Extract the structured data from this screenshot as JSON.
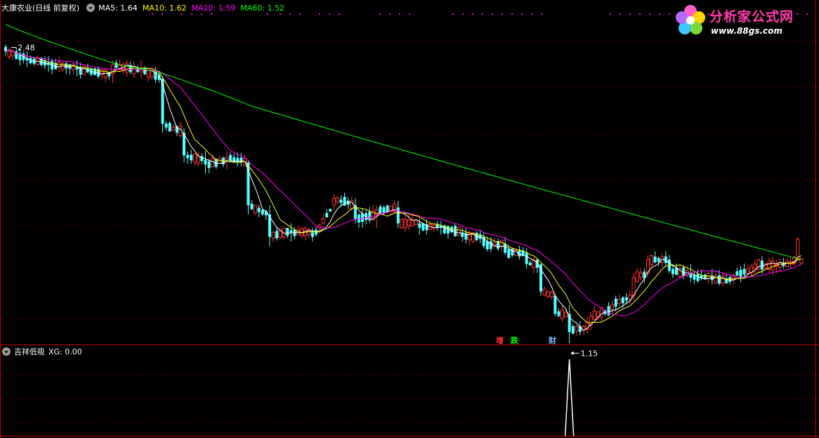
{
  "header": {
    "stock_title": "大康农业(日线 前复权)",
    "ma5": "MA5: 1.64",
    "ma10": "MA10: 1.62",
    "ma20": "MA20: 1.59",
    "ma60": "MA60: 1.52"
  },
  "indicator_header": {
    "name": "吉祥低吸",
    "value": "XG: 0.00"
  },
  "logo": {
    "text": "分析家公式网",
    "url": "www.88gs.com"
  },
  "labels": {
    "zeng": "增",
    "die": "跌",
    "cai": "财"
  },
  "colors": {
    "up": "#ff3232",
    "down": "#54ffff",
    "ma5": "#ffffff",
    "ma10": "#ffff00",
    "ma20": "#ff00ff",
    "ma60": "#00ff00",
    "grid": "#8b0000",
    "axis": "#c00000"
  },
  "chart_data": {
    "type": "candlestick",
    "y_range": [
      1.12,
      2.58
    ],
    "annotations": [
      {
        "text": "2.48",
        "at": "high"
      },
      {
        "text": "1.15",
        "at": "low"
      }
    ],
    "ohlc_ref": [
      [
        0,
        2.46,
        2.47,
        2.42,
        2.44
      ],
      [
        6,
        2.41,
        2.44,
        2.37,
        2.4
      ],
      [
        12,
        2.39,
        2.42,
        2.35,
        2.38
      ],
      [
        20,
        2.37,
        2.4,
        2.33,
        2.36
      ],
      [
        30,
        2.34,
        2.4,
        2.3,
        2.38
      ],
      [
        38,
        2.35,
        2.4,
        2.32,
        2.36
      ],
      [
        44,
        2.32,
        2.33,
        2.08,
        2.12
      ],
      [
        50,
        2.08,
        2.1,
        1.95,
        1.98
      ],
      [
        56,
        1.96,
        2.0,
        1.9,
        1.94
      ],
      [
        62,
        1.96,
        2.0,
        1.92,
        1.97
      ],
      [
        68,
        1.95,
        1.96,
        1.72,
        1.76
      ],
      [
        74,
        1.72,
        1.76,
        1.58,
        1.62
      ],
      [
        80,
        1.65,
        1.68,
        1.6,
        1.64
      ],
      [
        86,
        1.64,
        1.66,
        1.6,
        1.62
      ],
      [
        92,
        1.76,
        1.81,
        1.74,
        1.79
      ],
      [
        98,
        1.76,
        1.79,
        1.68,
        1.7
      ],
      [
        104,
        1.72,
        1.76,
        1.66,
        1.74
      ],
      [
        110,
        1.75,
        1.78,
        1.66,
        1.68
      ],
      [
        116,
        1.68,
        1.7,
        1.63,
        1.66
      ],
      [
        122,
        1.67,
        1.69,
        1.63,
        1.66
      ],
      [
        128,
        1.64,
        1.66,
        1.6,
        1.62
      ],
      [
        134,
        1.62,
        1.64,
        1.57,
        1.58
      ],
      [
        140,
        1.59,
        1.62,
        1.54,
        1.55
      ],
      [
        146,
        1.55,
        1.57,
        1.48,
        1.5
      ],
      [
        150,
        1.5,
        1.5,
        1.36,
        1.38
      ],
      [
        154,
        1.36,
        1.37,
        1.27,
        1.28
      ],
      [
        158,
        1.28,
        1.32,
        1.15,
        1.2
      ],
      [
        164,
        1.23,
        1.29,
        1.21,
        1.27
      ],
      [
        170,
        1.3,
        1.34,
        1.28,
        1.32
      ],
      [
        176,
        1.36,
        1.46,
        1.34,
        1.44
      ],
      [
        180,
        1.46,
        1.54,
        1.44,
        1.52
      ],
      [
        186,
        1.52,
        1.54,
        1.46,
        1.47
      ],
      [
        192,
        1.46,
        1.5,
        1.42,
        1.44
      ],
      [
        198,
        1.45,
        1.48,
        1.41,
        1.43
      ],
      [
        204,
        1.43,
        1.46,
        1.41,
        1.45
      ],
      [
        210,
        1.48,
        1.52,
        1.46,
        1.5
      ],
      [
        216,
        1.49,
        1.52,
        1.46,
        1.5
      ],
      [
        220,
        1.5,
        1.53,
        1.48,
        1.51
      ],
      [
        222,
        1.52,
        1.62,
        1.52,
        1.61
      ]
    ],
    "xg_signal_index": 158
  }
}
